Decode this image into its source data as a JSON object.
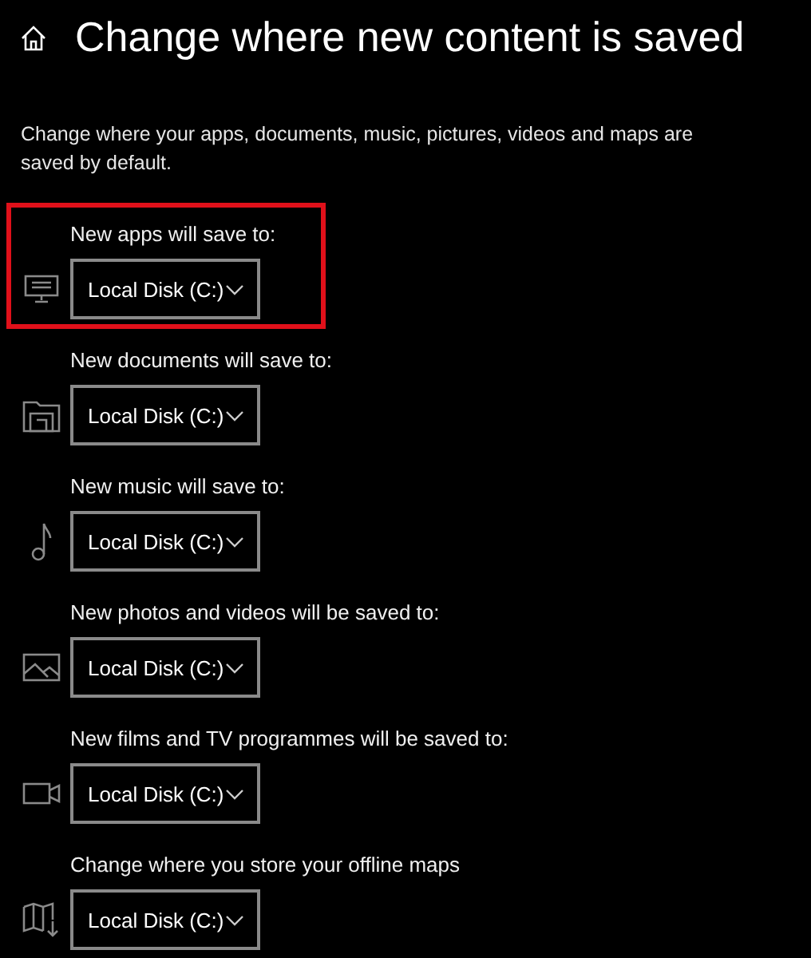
{
  "header": {
    "title": "Change where new content is saved"
  },
  "description": "Change where your apps, documents, music, pictures, videos and maps are saved by default.",
  "locations": [
    {
      "kind": "apps",
      "label": "New apps will save to:",
      "value": "Local Disk (C:)",
      "highlighted": true
    },
    {
      "kind": "documents",
      "label": "New documents will save to:",
      "value": "Local Disk (C:)",
      "highlighted": false
    },
    {
      "kind": "music",
      "label": "New music will save to:",
      "value": "Local Disk (C:)",
      "highlighted": false
    },
    {
      "kind": "photos",
      "label": "New photos and videos will be saved to:",
      "value": "Local Disk (C:)",
      "highlighted": false
    },
    {
      "kind": "films",
      "label": "New films and TV programmes will be saved to:",
      "value": "Local Disk (C:)",
      "highlighted": false
    },
    {
      "kind": "maps",
      "label": "Change where you store your offline maps",
      "value": "Local Disk (C:)",
      "highlighted": false
    }
  ]
}
